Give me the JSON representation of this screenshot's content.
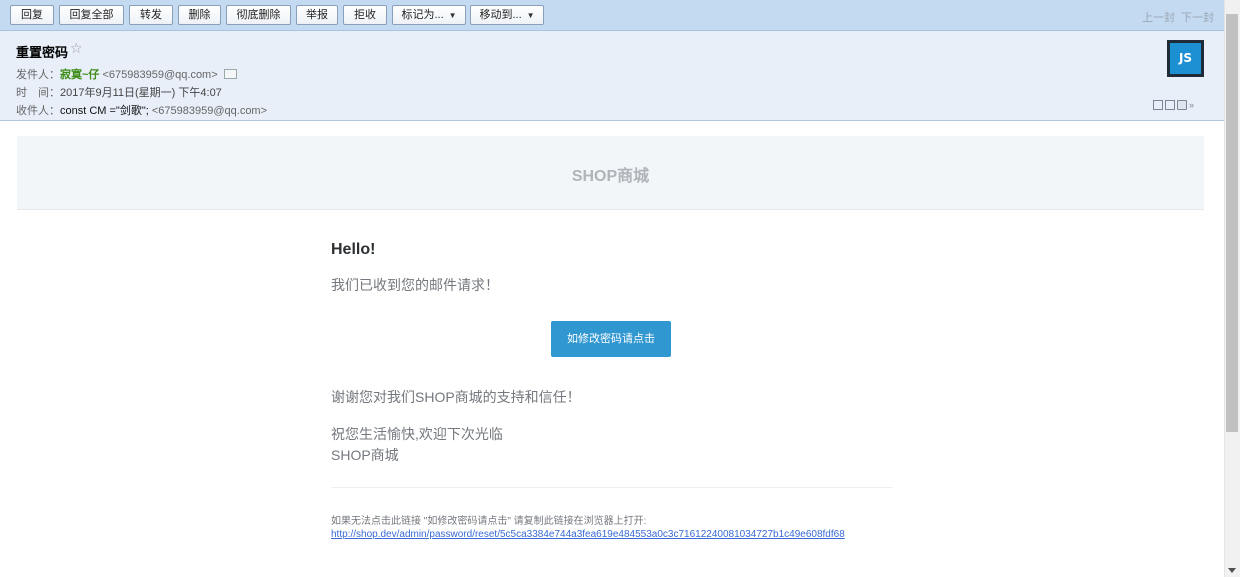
{
  "toolbar": {
    "buttons": [
      {
        "label": "回复"
      },
      {
        "label": "回复全部"
      },
      {
        "label": "转发"
      },
      {
        "label": "删除"
      },
      {
        "label": "彻底删除"
      },
      {
        "label": "举报"
      },
      {
        "label": "拒收"
      },
      {
        "label": "标记为..."
      },
      {
        "label": "移动到..."
      }
    ],
    "prev": "上一封",
    "next": "下一封"
  },
  "header": {
    "subject": "重置密码",
    "star_icon": "star-outline-icon",
    "from_label": "发件人：",
    "from_name": "寂寞~仔",
    "from_addr": "<675983959@qq.com>",
    "time_label": "时　间：",
    "time_value": "2017年9月11日(星期一) 下午4:07",
    "to_label": "收件人：",
    "to_name": "const CM =\"剑歌\";",
    "to_addr": "<675983959@qq.com>",
    "avatar_text": "JS",
    "avatar_color": "#1d90d4"
  },
  "body": {
    "banner_title": "SHOP商城",
    "greeting": "Hello!",
    "received": "我们已收到您的邮件请求！",
    "button_label": "如修改密码请点击",
    "button_color": "#3097d1",
    "thanks": "谢谢您对我们SHOP商城的支持和信任！",
    "wish": "祝您生活愉快,欢迎下次光临",
    "signature": "SHOP商城",
    "fallback_text": "如果无法点击此链接 \"如修改密码请点击\" 请复制此链接在浏览器上打开:",
    "reset_url": "http://shop.dev/admin/password/reset/5c5ca3384e744a3fea619e484553a0c3c71612240081034727b1c49e608fdf68"
  }
}
